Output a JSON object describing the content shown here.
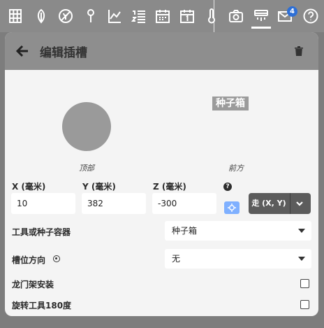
{
  "nav": {
    "icons": [
      "grid-icon",
      "leaf-icon",
      "no-weeds-icon",
      "pin-icon",
      "chart-icon",
      "sequence-list-icon",
      "calendar-icon",
      "calendar-one-icon",
      "thermometer-icon",
      "camera-icon",
      "gantry-icon",
      "mail-icon",
      "help-circle-icon"
    ],
    "badge_count": "4"
  },
  "panel": {
    "title": "编辑插槽",
    "seed_tag": "种子箱",
    "top_caption": "顶部",
    "front_caption": "前方",
    "x_label": "X (毫米)",
    "y_label": "Y (毫米)",
    "z_label": "Z (毫米)",
    "x_value": "10",
    "y_value": "382",
    "z_value": "-300",
    "go_label": "走 (X, Y)",
    "help_glyph": "?",
    "tool_label": "工具或种子容器",
    "tool_value": "种子箱",
    "direction_label": "槽位方向",
    "direction_value": "无",
    "gantry_label": "龙门架安装",
    "rotate_label": "旋转工具180度"
  },
  "colors": {
    "accent": "#2d6fd6",
    "header": "#8e8e8e",
    "panel": "#f4f4f4",
    "crosshair_button": "#7fb0ff",
    "go_button": "#5c5c5c"
  }
}
